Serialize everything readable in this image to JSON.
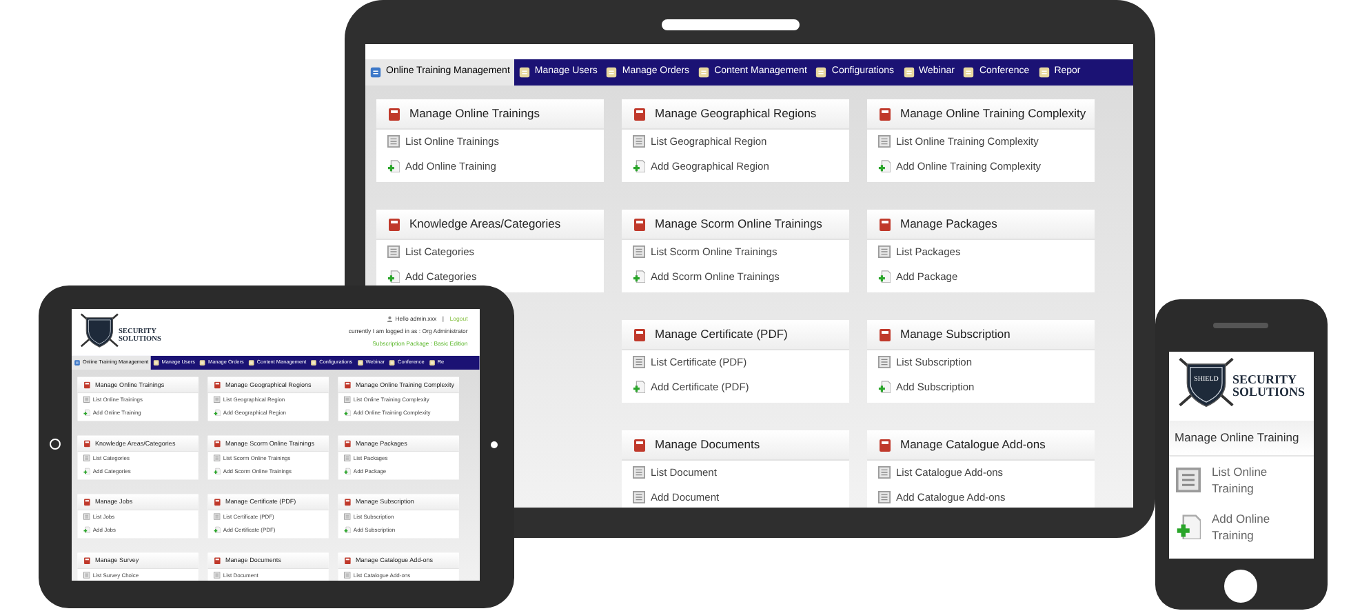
{
  "main_tablet": {
    "nav_tabs": [
      {
        "label": "Online Training Management",
        "selected": true
      },
      {
        "label": "Manage Users",
        "selected": false
      },
      {
        "label": "Manage Orders",
        "selected": false
      },
      {
        "label": "Content Management",
        "selected": false
      },
      {
        "label": "Configurations",
        "selected": false
      },
      {
        "label": "Webinar",
        "selected": false
      },
      {
        "label": "Conference",
        "selected": false
      },
      {
        "label": "Repor",
        "selected": false
      }
    ],
    "columns": [
      [
        {
          "title": "Manage Online Trainings",
          "links": [
            {
              "kind": "list",
              "label": "List Online Trainings"
            },
            {
              "kind": "add",
              "label": "Add Online Training"
            }
          ]
        },
        {
          "title": "Knowledge Areas/Categories",
          "links": [
            {
              "kind": "list",
              "label": "List Categories"
            },
            {
              "kind": "add",
              "label": "Add Categories"
            }
          ]
        }
      ],
      [
        {
          "title": "Manage Geographical Regions",
          "links": [
            {
              "kind": "list",
              "label": "List Geographical Region"
            },
            {
              "kind": "add",
              "label": "Add Geographical Region"
            }
          ]
        },
        {
          "title": "Manage Scorm Online Trainings",
          "links": [
            {
              "kind": "list",
              "label": "List Scorm Online Trainings"
            },
            {
              "kind": "add",
              "label": "Add Scorm Online Trainings"
            }
          ]
        },
        {
          "title": "Manage Certificate (PDF)",
          "links": [
            {
              "kind": "list",
              "label": "List Certificate (PDF)"
            },
            {
              "kind": "add",
              "label": "Add Certificate (PDF)"
            }
          ]
        },
        {
          "title": "Manage Documents",
          "links": [
            {
              "kind": "list",
              "label": "List Document"
            },
            {
              "kind": "list",
              "label": "Add Document"
            }
          ]
        }
      ],
      [
        {
          "title": "Manage Online Training Complexity",
          "links": [
            {
              "kind": "list",
              "label": "List Online Training Complexity"
            },
            {
              "kind": "add",
              "label": "Add Online Training Complexity"
            }
          ]
        },
        {
          "title": "Manage Packages",
          "links": [
            {
              "kind": "list",
              "label": "List Packages"
            },
            {
              "kind": "add",
              "label": "Add Package"
            }
          ]
        },
        {
          "title": "Manage Subscription",
          "links": [
            {
              "kind": "list",
              "label": "List Subscription"
            },
            {
              "kind": "add",
              "label": "Add Subscription"
            }
          ]
        },
        {
          "title": "Manage Catalogue Add-ons",
          "links": [
            {
              "kind": "list",
              "label": "List Catalogue Add-ons"
            },
            {
              "kind": "list",
              "label": "Add Catalogue Add-ons"
            }
          ]
        }
      ]
    ]
  },
  "small_tablet": {
    "header": {
      "logo": {
        "name_lines": [
          "SECURITY",
          "SOLUTIONS"
        ]
      },
      "user": "Hello admin.xxx",
      "separator": "|",
      "logout": "Logout",
      "logged_in_as": "currently I am logged in as : Org Administrator",
      "subscription": "Subscription Package : Basic Edition"
    },
    "nav_tabs": [
      {
        "label": "Online Training Management",
        "selected": true
      },
      {
        "label": "Manage Users",
        "selected": false
      },
      {
        "label": "Manage Orders",
        "selected": false
      },
      {
        "label": "Content Management",
        "selected": false
      },
      {
        "label": "Configurations",
        "selected": false
      },
      {
        "label": "Webinar",
        "selected": false
      },
      {
        "label": "Conference",
        "selected": false
      },
      {
        "label": "Re",
        "selected": false
      }
    ],
    "columns": [
      [
        {
          "title": "Manage Online Trainings",
          "links": [
            {
              "kind": "list",
              "label": "List Online Trainings"
            },
            {
              "kind": "add",
              "label": "Add Online Training"
            }
          ]
        },
        {
          "title": "Knowledge Areas/Categories",
          "links": [
            {
              "kind": "list",
              "label": "List Categories"
            },
            {
              "kind": "add",
              "label": "Add Categories"
            }
          ]
        },
        {
          "title": "Manage Jobs",
          "links": [
            {
              "kind": "list",
              "label": "List Jobs"
            },
            {
              "kind": "add",
              "label": "Add Jobs"
            }
          ]
        },
        {
          "title": "Manage Survey",
          "links": [
            {
              "kind": "list",
              "label": "List Survey Choice"
            }
          ]
        }
      ],
      [
        {
          "title": "Manage Geographical Regions",
          "links": [
            {
              "kind": "list",
              "label": "List Geographical Region"
            },
            {
              "kind": "add",
              "label": "Add Geographical Region"
            }
          ]
        },
        {
          "title": "Manage Scorm Online Trainings",
          "links": [
            {
              "kind": "list",
              "label": "List Scorm Online Trainings"
            },
            {
              "kind": "add",
              "label": "Add Scorm Online Trainings"
            }
          ]
        },
        {
          "title": "Manage Certificate (PDF)",
          "links": [
            {
              "kind": "list",
              "label": "List Certificate (PDF)"
            },
            {
              "kind": "add",
              "label": "Add Certificate (PDF)"
            }
          ]
        },
        {
          "title": "Manage Documents",
          "links": [
            {
              "kind": "list",
              "label": "List Document"
            }
          ]
        }
      ],
      [
        {
          "title": "Manage Online Training Complexity",
          "links": [
            {
              "kind": "list",
              "label": "List Online Training Complexity"
            },
            {
              "kind": "add",
              "label": "Add Online Training Complexity"
            }
          ]
        },
        {
          "title": "Manage Packages",
          "links": [
            {
              "kind": "list",
              "label": "List Packages"
            },
            {
              "kind": "add",
              "label": "Add Package"
            }
          ]
        },
        {
          "title": "Manage Subscription",
          "links": [
            {
              "kind": "list",
              "label": "List Subscription"
            },
            {
              "kind": "add",
              "label": "Add Subscription"
            }
          ]
        },
        {
          "title": "Manage Catalogue Add-ons",
          "links": [
            {
              "kind": "list",
              "label": "List Catalogue Add-ons"
            }
          ]
        }
      ]
    ]
  },
  "phone": {
    "logo": {
      "badge": "SHIELD",
      "name_lines": [
        "SECURITY",
        "SOLUTIONS"
      ]
    },
    "module_title": "Manage Online Training",
    "links": [
      {
        "kind": "list",
        "label": "List Online Training"
      },
      {
        "kind": "add",
        "label": "Add Online Training"
      }
    ]
  }
}
